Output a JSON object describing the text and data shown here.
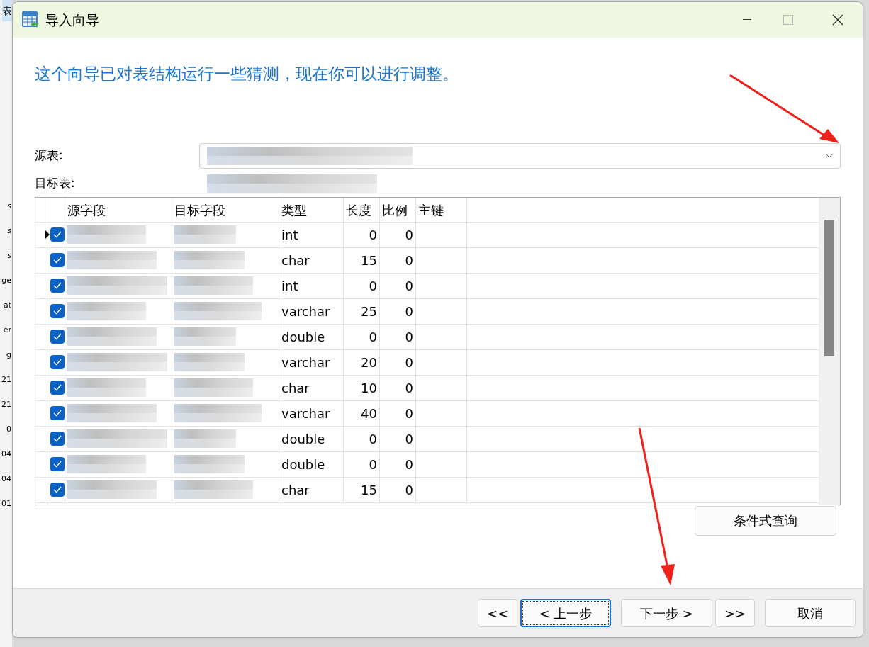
{
  "background": {
    "tab_fragment": "表",
    "fragments": [
      "s",
      "s",
      "s",
      "ge",
      "at",
      "er",
      "g",
      "21",
      "21",
      "0",
      "04",
      "04",
      "01"
    ]
  },
  "window": {
    "title": "导入向导"
  },
  "heading": "这个向导已对表结构运行一些猜测，现在你可以进行调整。",
  "source_table": {
    "label": "源表:"
  },
  "target_table": {
    "label": "目标表:"
  },
  "table": {
    "columns": [
      "源字段",
      "目标字段",
      "类型",
      "长度",
      "比例",
      "主键"
    ],
    "rows": [
      {
        "current": true,
        "checked": true,
        "type": "int",
        "length": "0",
        "scale": "0"
      },
      {
        "current": false,
        "checked": true,
        "type": "char",
        "length": "15",
        "scale": "0"
      },
      {
        "current": false,
        "checked": true,
        "type": "int",
        "length": "0",
        "scale": "0"
      },
      {
        "current": false,
        "checked": true,
        "type": "varchar",
        "length": "25",
        "scale": "0"
      },
      {
        "current": false,
        "checked": true,
        "type": "double",
        "length": "0",
        "scale": "0"
      },
      {
        "current": false,
        "checked": true,
        "type": "varchar",
        "length": "20",
        "scale": "0"
      },
      {
        "current": false,
        "checked": true,
        "type": "char",
        "length": "10",
        "scale": "0"
      },
      {
        "current": false,
        "checked": true,
        "type": "varchar",
        "length": "40",
        "scale": "0"
      },
      {
        "current": false,
        "checked": true,
        "type": "double",
        "length": "0",
        "scale": "0"
      },
      {
        "current": false,
        "checked": true,
        "type": "double",
        "length": "0",
        "scale": "0"
      },
      {
        "current": false,
        "checked": true,
        "type": "char",
        "length": "15",
        "scale": "0"
      }
    ]
  },
  "condition_button": "条件式查询",
  "footer_buttons": [
    {
      "label": "<<",
      "focused": false
    },
    {
      "label": "< 上一步",
      "focused": true
    },
    {
      "label": "下一步 >",
      "focused": false
    },
    {
      "label": ">>",
      "focused": false
    },
    {
      "label": "取消",
      "focused": false
    }
  ]
}
